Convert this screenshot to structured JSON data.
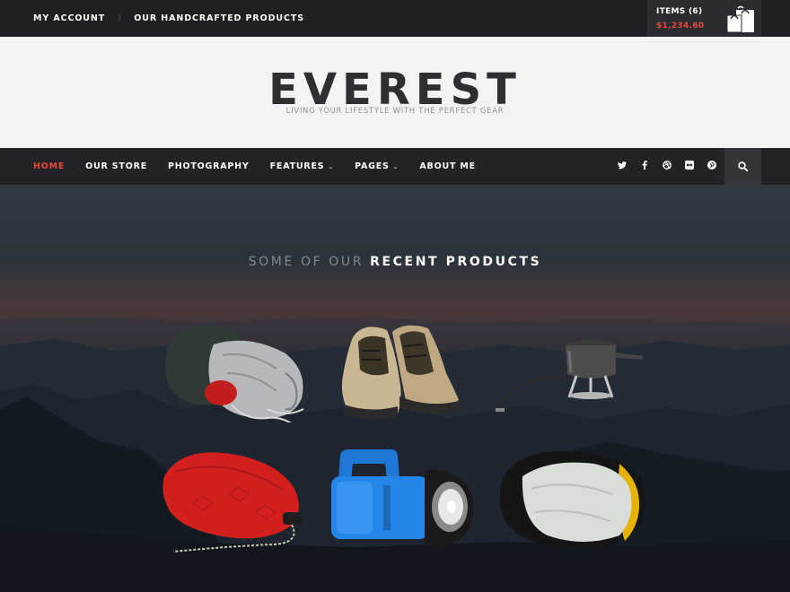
{
  "topbar": {
    "links": [
      "MY ACCOUNT",
      "OUR HANDCRAFTED PRODUCTS"
    ],
    "separator": "/"
  },
  "cart": {
    "items_label": "ITEMS (6)",
    "total": "$1,234.60",
    "icon": "shopping-bag-icon"
  },
  "header": {
    "logo": "EVEREST",
    "tagline": "LIVING YOUR LIFESTYLE WITH THE PERFECT GEAR"
  },
  "nav": {
    "items": [
      {
        "label": "HOME",
        "active": true,
        "has_dropdown": false
      },
      {
        "label": "OUR STORE",
        "active": false,
        "has_dropdown": false
      },
      {
        "label": "PHOTOGRAPHY",
        "active": false,
        "has_dropdown": false
      },
      {
        "label": "FEATURES",
        "active": false,
        "has_dropdown": true
      },
      {
        "label": "PAGES",
        "active": false,
        "has_dropdown": true
      },
      {
        "label": "ABOUT ME",
        "active": false,
        "has_dropdown": false
      }
    ],
    "caret": "⌄",
    "social_icons": [
      "twitter-icon",
      "facebook-icon",
      "dribbble-icon",
      "flickr-icon",
      "pinterest-icon"
    ],
    "search_icon": "search-icon"
  },
  "hero": {
    "title_prefix": "SOME OF OUR",
    "title_main": "RECENT PRODUCTS",
    "products": [
      "stuff-sacks",
      "hiking-boots",
      "camping-stove",
      "red-compression-sack",
      "blue-lantern",
      "sleeping-bag-sack"
    ]
  },
  "colors": {
    "accent": "#e8483a",
    "topbar_bg": "#1f2024",
    "header_bg": "#f3f3f4",
    "nav_bg": "#222327",
    "logo": "#2d2f33"
  }
}
